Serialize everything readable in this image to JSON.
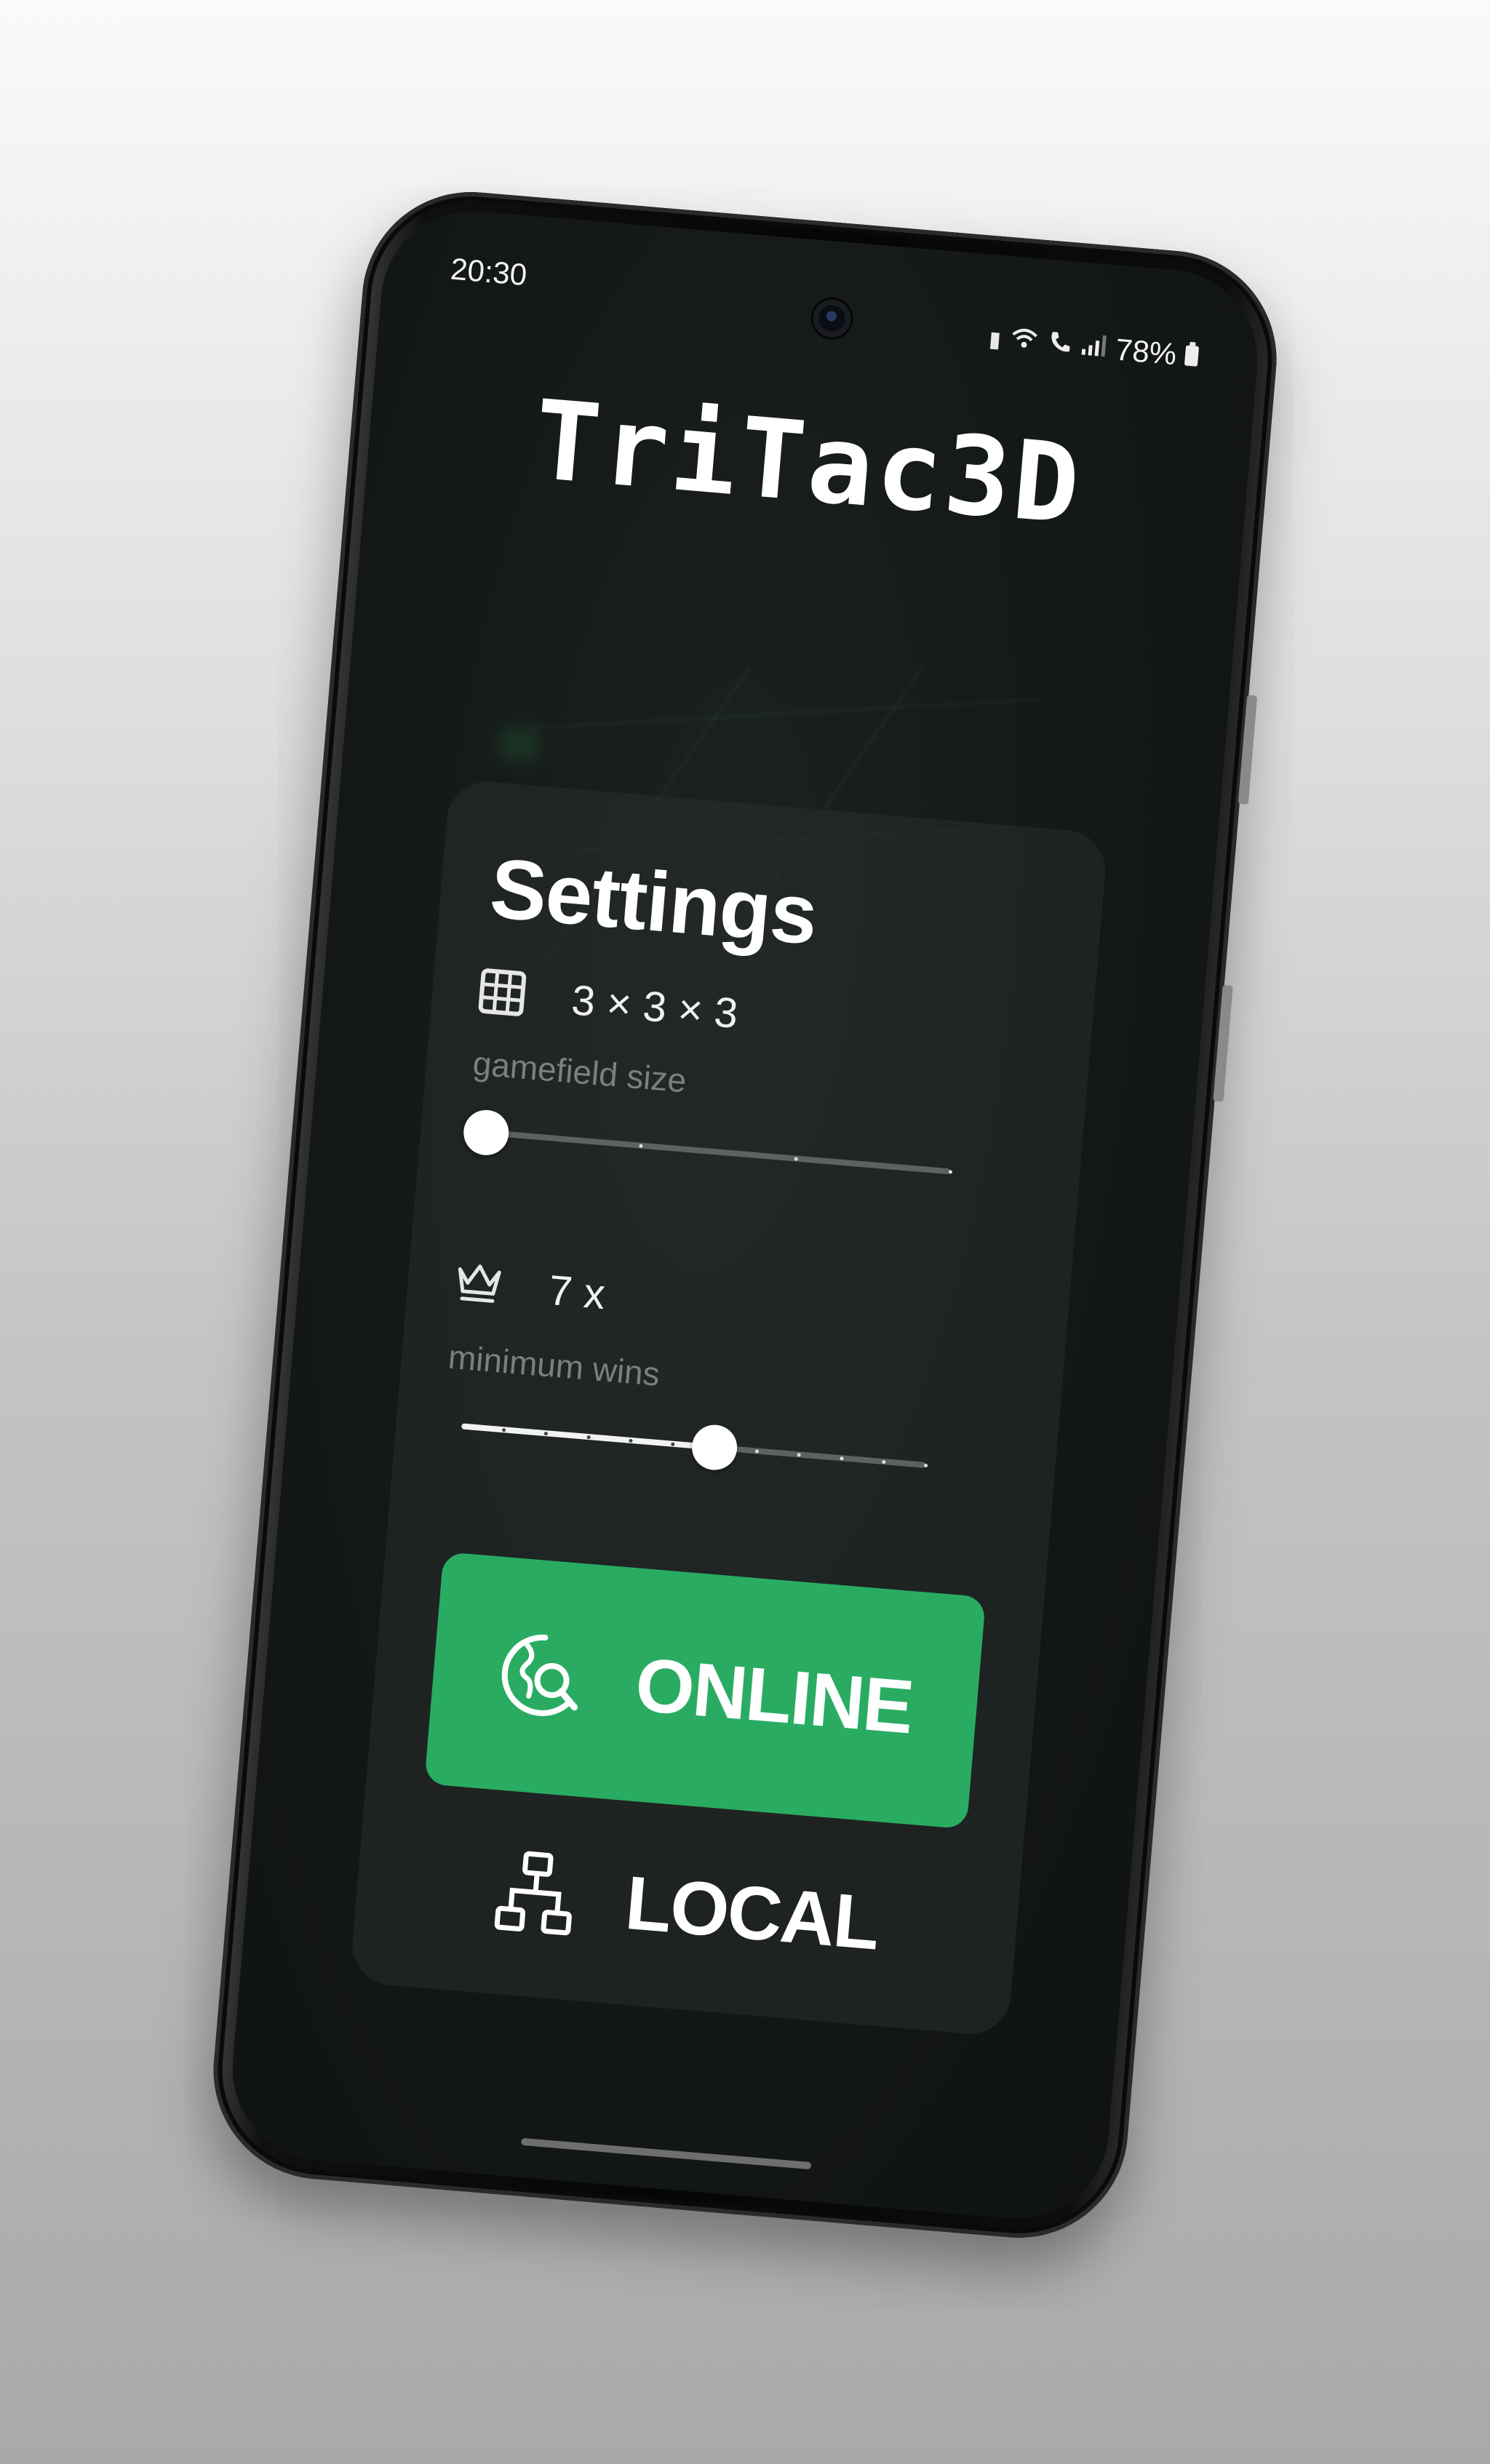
{
  "status_bar": {
    "time": "20:30",
    "battery": "78%",
    "icons": [
      "battery-saver-icon",
      "wifi-call-icon",
      "call-icon",
      "signal-icon",
      "battery-icon"
    ]
  },
  "app": {
    "title": "TriTac3D"
  },
  "settings": {
    "title": "Settings",
    "gamefield_size": {
      "icon": "grid-icon",
      "value": "3 × 3 × 3",
      "caption": "gamefield size",
      "slider": {
        "steps": 4,
        "selected_index": 0
      }
    },
    "minimum_wins": {
      "icon": "crown-icon",
      "value": "7 x",
      "caption": "minimum wins",
      "slider": {
        "steps": 12,
        "selected_index": 6
      }
    }
  },
  "actions": {
    "online": {
      "label": "ONLINE",
      "icon": "globe-search-icon",
      "color": "#29ac62"
    },
    "local": {
      "label": "LOCAL",
      "icon": "hierarchy-icon"
    }
  }
}
